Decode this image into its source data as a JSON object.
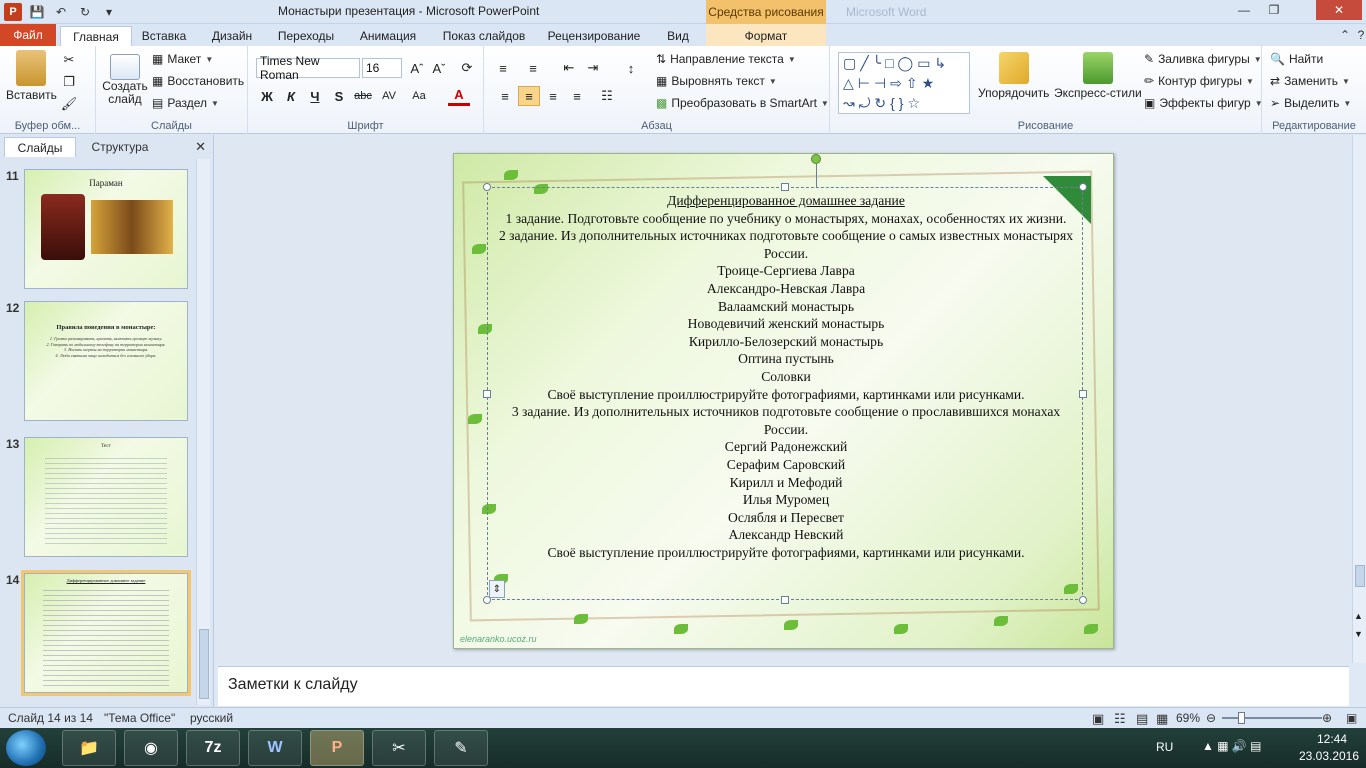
{
  "titlebar": {
    "title": "Монастыри презентация  -  Microsoft PowerPoint",
    "context_tab": "Средства рисования",
    "ghost_window": "Microsoft Word",
    "app_icon": "P"
  },
  "tabs": [
    {
      "label": "Файл"
    },
    {
      "label": "Главная"
    },
    {
      "label": "Вставка"
    },
    {
      "label": "Дизайн"
    },
    {
      "label": "Переходы"
    },
    {
      "label": "Анимация"
    },
    {
      "label": "Показ слайдов"
    },
    {
      "label": "Рецензирование"
    },
    {
      "label": "Вид"
    },
    {
      "label": "Формат"
    }
  ],
  "ribbon": {
    "clipboard": {
      "paste": "Вставить",
      "label": "Буфер обм..."
    },
    "slides": {
      "new_slide": "Создать слайд",
      "layout": "Макет",
      "reset": "Восстановить",
      "section": "Раздел",
      "label": "Слайды"
    },
    "font": {
      "name": "Times New Roman",
      "size": "16",
      "bold": "Ж",
      "italic": "К",
      "underline": "Ч",
      "shadow": "S",
      "strike": "abc",
      "spacing": "AV",
      "case": "Aa",
      "color": "A",
      "label": "Шрифт"
    },
    "paragraph": {
      "text_dir": "Направление текста",
      "align_text": "Выровнять текст",
      "smartart": "Преобразовать в SmartArt",
      "label": "Абзац"
    },
    "drawing": {
      "arrange": "Упорядочить",
      "quick_styles": "Экспресс-стили",
      "fill": "Заливка фигуры",
      "outline": "Контур фигуры",
      "effects": "Эффекты фигур",
      "label": "Рисование"
    },
    "editing": {
      "find": "Найти",
      "replace": "Заменить",
      "select": "Выделить",
      "label": "Редактирование"
    }
  },
  "left_pane": {
    "tab_slides": "Слайды",
    "tab_outline": "Структура",
    "thumbnails": [
      {
        "num": "11",
        "title": "Параман"
      },
      {
        "num": "12",
        "title": "Правила поведения в монастыре:",
        "lines": [
          "1. Громко разговаривать, кричать, включать громкую музыку.",
          "2. Говорить по мобильному телефону на территории монастыря.",
          "3. Носить шорты на территории монастыря.",
          "4. Люди святыми чаще находиться без головного убора."
        ]
      },
      {
        "num": "13",
        "title": "Тест"
      },
      {
        "num": "14",
        "title": "Дифференцированное домашнее задание"
      }
    ]
  },
  "slide": {
    "heading": "Дифференцированное  домашнее задание",
    "lines": [
      "1 задание.  Подготовьте сообщение по учебнику о монастырях, монахах, особенностях их жизни.",
      "2 задание.  Из дополнительных  источниках подготовьте сообщение о самых известных монастырях России.",
      "Троице-Сергиева Лавра",
      "Александро-Невская Лавра",
      "Валаамский монастырь",
      "Новодевичий женский монастырь",
      "Кирилло-Белозерский  монастырь",
      "Оптина пустынь",
      "Соловки",
      "Своё выступление проиллюстрируйте  фотографиями, картинками или  рисунками.",
      "3 задание.  Из дополнительных  источников подготовьте сообщение о прославившихся монахах России.",
      "Сергий Радонежский",
      "Серафим Саровский",
      "Кирилл и Мефодий",
      "Илья Муромец",
      "Ослябля и Пересвет",
      "Александр Невский",
      "Своё выступление проиллюстрируйте  фотографиями, картинками или  рисунками."
    ],
    "watermark": "elenaranko.ucoz.ru"
  },
  "notes": {
    "placeholder": "Заметки к слайду"
  },
  "status": {
    "slide": "Слайд 14 из 14",
    "theme": "\"Тема Office\"",
    "lang": "русский",
    "zoom": "69%",
    "zoom_value": 0.69
  },
  "taskbar": {
    "lang": "RU",
    "time": "12:44",
    "date": "23.03.2016"
  },
  "colors": {
    "file_tab": "#d24726",
    "context_tab": "#f3c06b",
    "accent": "#2b579a"
  }
}
